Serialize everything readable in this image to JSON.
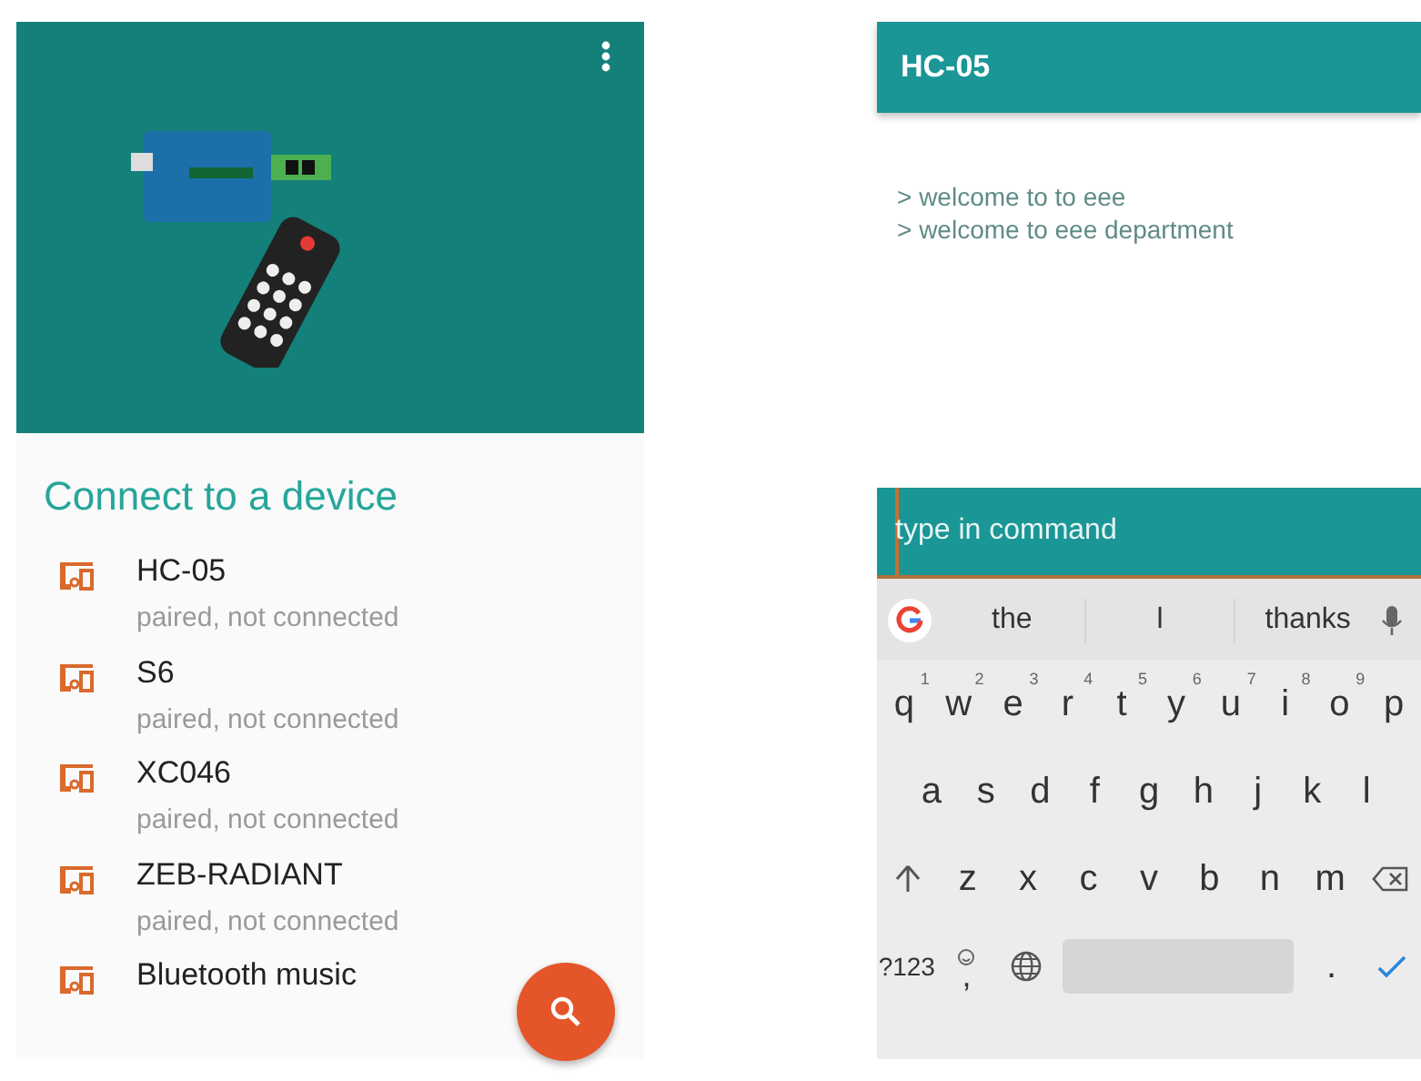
{
  "device_list_screen": {
    "heading": "Connect to a device",
    "devices": [
      {
        "name": "HC-05",
        "status": "paired, not connected"
      },
      {
        "name": "S6",
        "status": "paired, not connected"
      },
      {
        "name": "XC046",
        "status": "paired, not connected"
      },
      {
        "name": "ZEB-RADIANT",
        "status": "paired, not connected"
      },
      {
        "name": "Bluetooth music"
      }
    ]
  },
  "terminal_screen": {
    "title": "HC-05",
    "messages": [
      "> welcome to to eee",
      "> welcome to eee department"
    ],
    "command_field": {
      "placeholder": "type in command"
    },
    "keyboard": {
      "suggestions": [
        "the",
        "l",
        "thanks"
      ],
      "rows": [
        [
          {
            "kind": "letter",
            "label": "q",
            "hint": "1"
          },
          {
            "kind": "letter",
            "label": "w",
            "hint": "2"
          },
          {
            "kind": "letter",
            "label": "e",
            "hint": "3"
          },
          {
            "kind": "letter",
            "label": "r",
            "hint": "4"
          },
          {
            "kind": "letter",
            "label": "t",
            "hint": "5"
          },
          {
            "kind": "letter",
            "label": "y",
            "hint": "6"
          },
          {
            "kind": "letter",
            "label": "u",
            "hint": "7"
          },
          {
            "kind": "letter",
            "label": "i",
            "hint": "8"
          },
          {
            "kind": "letter",
            "label": "o",
            "hint": "9"
          },
          {
            "kind": "letter",
            "label": "p"
          }
        ],
        [
          {
            "kind": "letter",
            "label": "a"
          },
          {
            "kind": "letter",
            "label": "s"
          },
          {
            "kind": "letter",
            "label": "d"
          },
          {
            "kind": "letter",
            "label": "f"
          },
          {
            "kind": "letter",
            "label": "g"
          },
          {
            "kind": "letter",
            "label": "h"
          },
          {
            "kind": "letter",
            "label": "j"
          },
          {
            "kind": "letter",
            "label": "k"
          },
          {
            "kind": "letter",
            "label": "l"
          }
        ],
        [
          {
            "kind": "shift"
          },
          {
            "kind": "letter",
            "label": "z"
          },
          {
            "kind": "letter",
            "label": "x"
          },
          {
            "kind": "letter",
            "label": "c"
          },
          {
            "kind": "letter",
            "label": "v"
          },
          {
            "kind": "letter",
            "label": "b"
          },
          {
            "kind": "letter",
            "label": "n"
          },
          {
            "kind": "letter",
            "label": "m"
          },
          {
            "kind": "backspace"
          }
        ],
        [
          {
            "kind": "symbols",
            "label": "?123"
          },
          {
            "kind": "comma",
            "label": ","
          },
          {
            "kind": "globe"
          },
          {
            "kind": "space"
          },
          {
            "kind": "letter",
            "label": "."
          },
          {
            "kind": "enter"
          }
        ]
      ]
    }
  }
}
